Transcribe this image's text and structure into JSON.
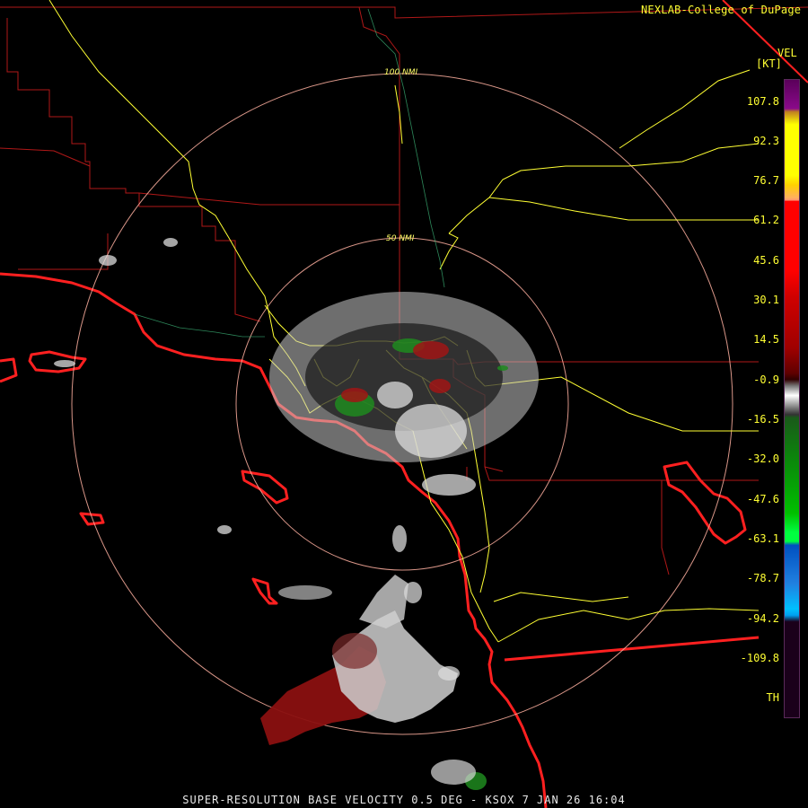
{
  "credit": "NEXLAB-College of DuPage",
  "credit_icon": "cursor-arrow-icon",
  "legend": {
    "title": "VEL",
    "unit": "[KT]",
    "ticks": [
      "107.8",
      "92.3",
      "76.7",
      "61.2",
      "45.6",
      "30.1",
      "14.5",
      "-0.9",
      "-16.5",
      "-32.0",
      "-47.6",
      "-63.1",
      "-78.7",
      "-94.2",
      "-109.8",
      "TH"
    ]
  },
  "rings": [
    "100 NMI",
    "50 NMI"
  ],
  "caption": "SUPER-RESOLUTION BASE VELOCITY 0.5 DEG - KSOX 7 JAN 26 16:04",
  "colors": {
    "background": "#000000",
    "label": "#ffff33",
    "coastline": "#ff2020",
    "county_lines": "#b01818",
    "highways": "#ffff33",
    "range_rings": "#ffb0a0",
    "inbound_green": "#1f8a1f",
    "outbound_red": "#8a1010",
    "near_zero_gray": "#c8c8c8"
  }
}
